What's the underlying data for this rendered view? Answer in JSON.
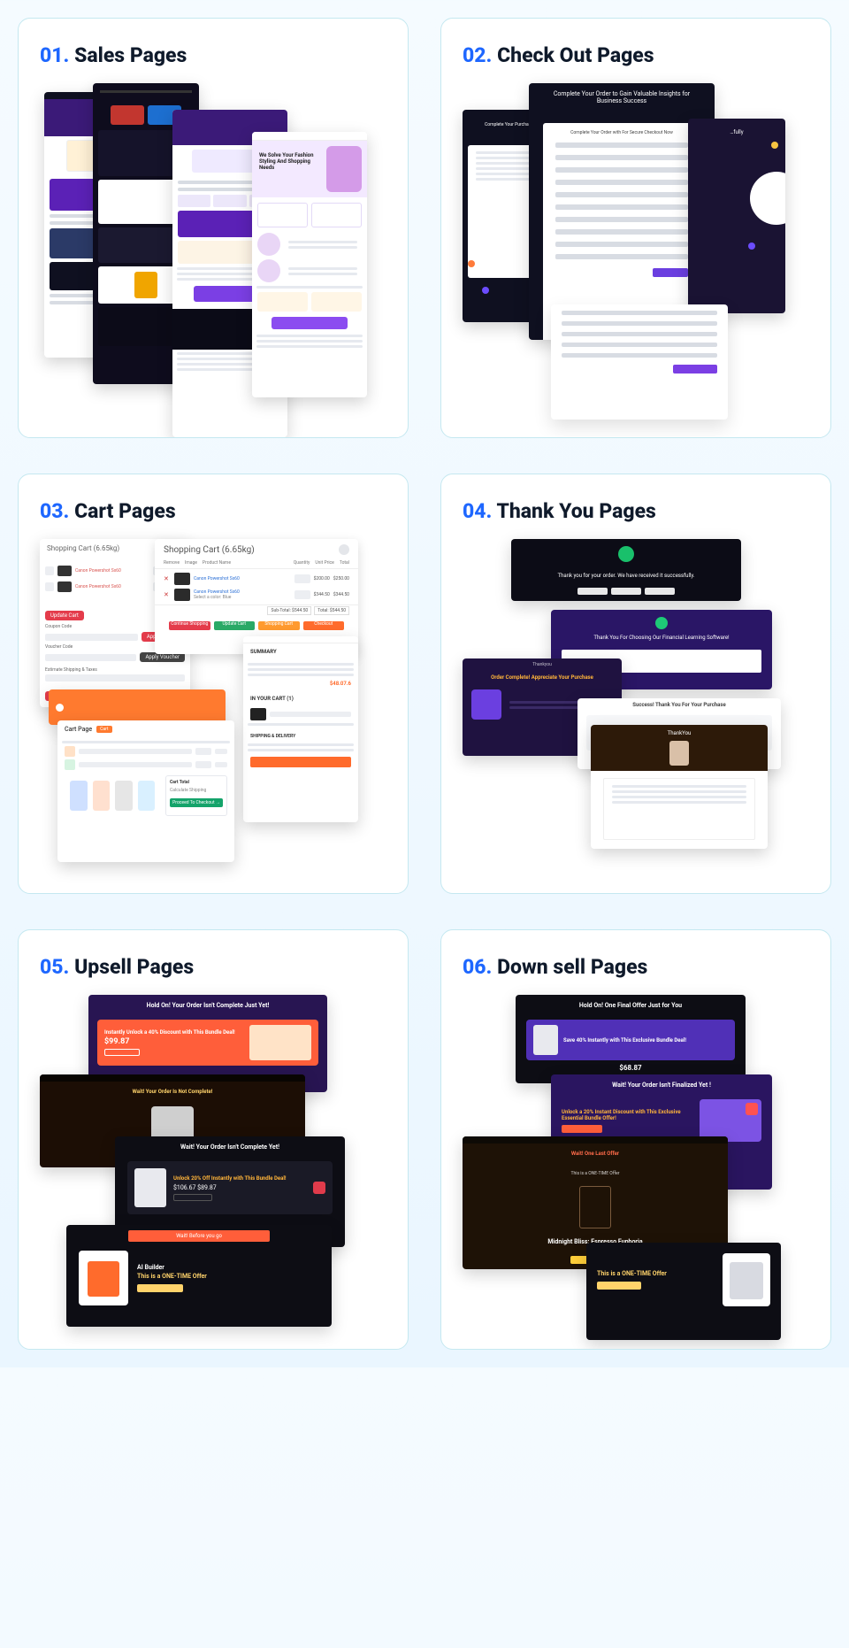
{
  "cards": [
    {
      "num": "01.",
      "title": "Sales Pages"
    },
    {
      "num": "02.",
      "title": "Check Out Pages"
    },
    {
      "num": "03.",
      "title": "Cart Pages"
    },
    {
      "num": "04.",
      "title": "Thank You Pages"
    },
    {
      "num": "05.",
      "title": "Upsell Pages"
    },
    {
      "num": "06.",
      "title": "Down sell  Pages"
    }
  ],
  "c2": {
    "headline": "Complete Your Order to Gain Valuable Insights for Business Success",
    "sub": "Complete Your Order with For Secure Checkout Now"
  },
  "c3": {
    "h1": "Shopping Cart  (6.65kg)",
    "h2": "Shopping Cart  (6.65kg)",
    "cols1": [
      "Remove",
      "Image",
      "Product Name",
      "Quantity",
      "Unit Price",
      "Total"
    ],
    "prod": "Canon Powershot Sx60",
    "colorLine": "Select a color: Blue",
    "p1": "$200.00",
    "p1t": "$250.00",
    "p2": "$344.50",
    "p2t": "$344.50",
    "subTotalLbl": "Sub-Total: $544.50",
    "totalLbl": "Total: $544.50",
    "btns": [
      "Continue Shopping",
      "Update Cart",
      "Shopping Cart",
      "Checkout"
    ],
    "summary": "SUMMARY",
    "inCart": "IN YOUR CART (1)",
    "cartPage": "Cart Page",
    "cartTotal": "Cart Total",
    "proceed": "Proceed To Checkout →",
    "calcShip": "Calculate Shipping",
    "updateCart": "Update Cart",
    "applyCoupon": "Apply Coupon",
    "estShip": "Estimate Shipping & Taxes",
    "voucher": "Voucher Code",
    "coupon": "Coupon Code"
  },
  "c4": {
    "t1": "Thank you for your order. We have received it successfully.",
    "t2": "Thank You For Choosing Our Financial Learning Software!",
    "t3a": "Thankyou",
    "t3b": "Order Complete! Appreciate Your Purchase",
    "t4": "Success! Thank You For Your Purchase",
    "t5": "ThankYou"
  },
  "c5": {
    "u1h": "Hold On! Your Order Isn't Complete Just Yet!",
    "u1s": "Instantly Unlock a 40% Discount with This Bundle Deal!",
    "u1p": "$99.87",
    "u2h": "Wait! Your Order Is Not Complete!",
    "u3h": "Wait! Your Order Isn't Complete Yet!",
    "u3s": "Unlock 20% Off Instantly with This Bundle Deal!",
    "u3p": "$106.67 $89.87",
    "u4b": "Wait! Before you go",
    "u4h": "AI Builder",
    "u4s": "This is a ONE-TIME Offer"
  },
  "c6": {
    "d1h": "Hold On! One Final Offer Just for You",
    "d1s": "Save 40% Instantly with This Exclusive Bundle Deal!",
    "d1p": "$68.87",
    "d2h": "Wait! Your Order Isn't Finalized Yet !",
    "d2s": "Unlock a 20% Instant Discount with This Exclusive Essential Bundle Offer!",
    "d3a": "Wait! One Last Offer",
    "d3b": "This is a ONE-TIME Offer",
    "d3h": "Midnight Bliss: Espresso Euphoria",
    "d4h": "This is a ONE-TIME Offer"
  }
}
